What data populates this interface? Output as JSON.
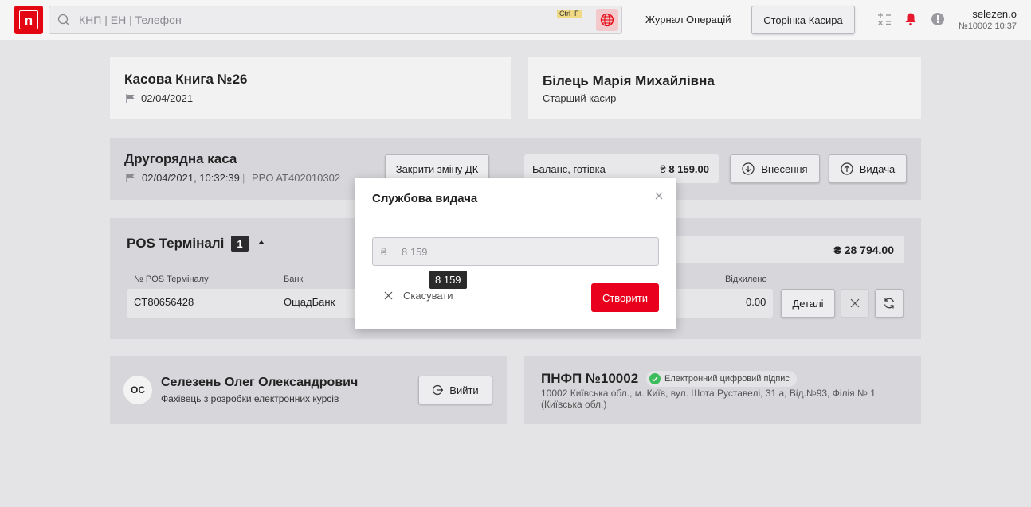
{
  "header": {
    "logo_label": "n",
    "search_placeholder": "КНП | ЕН | Телефон",
    "shortcut_ctrl": "Ctrl",
    "shortcut_key": "F",
    "journal_link": "Журнал Операцій",
    "cashier_page_button": "Сторінка Касира",
    "username": "selezen.o",
    "user_meta": "№10002 10:37"
  },
  "cashbook": {
    "title": "Касова Книга №26",
    "date": "02/04/2021"
  },
  "cashier": {
    "name": "Білець Марія Михайлівна",
    "role": "Старший касир"
  },
  "secondary_till": {
    "title": "Другорядна каса",
    "datetime": "02/04/2021, 10:32:39",
    "separator": "|",
    "rro": "PPO AT402010302",
    "close_shift_button": "Закрити зміну ДК",
    "balance_label": "Баланс, готівка",
    "balance_currency": "₴",
    "balance_value": "8 159.00",
    "deposit_button": "Внесення",
    "withdraw_button": "Видача"
  },
  "pos": {
    "title": "POS Терміналі",
    "count": "1",
    "total_currency": "₴",
    "total_value": "28 794.00",
    "col_terminal": "№ POS Терміналу",
    "col_bank": "Банк",
    "col_rejected": "Відхилено",
    "rows": [
      {
        "terminal": "CT80656428",
        "bank": "ОщадБанк",
        "rejected": "0.00"
      }
    ],
    "details_button": "Деталі"
  },
  "employee": {
    "initials": "ОС",
    "name": "Селезень Олег Олександрович",
    "position": "Фахівець з розробки електронних курсів",
    "logout_button": "Вийти"
  },
  "branch": {
    "title": "ПНФП №10002",
    "signature_badge": "Електронний цифровий підпис",
    "address": "10002 Київська обл., м. Київ, вул. Шота Руставелі, 31 а, Від.№93, Філія № 1 (Київська обл.)"
  },
  "modal": {
    "title": "Службова видача",
    "amount_currency": "₴",
    "amount_placeholder": "8 159",
    "cancel_label": "Скасувати",
    "create_label": "Створити"
  },
  "tooltip": {
    "text": "8 159"
  },
  "colors": {
    "brand_red": "#e30613",
    "create_red": "#e8001c",
    "notification_red": "#e8192c",
    "success_green": "#3dbc5c"
  }
}
